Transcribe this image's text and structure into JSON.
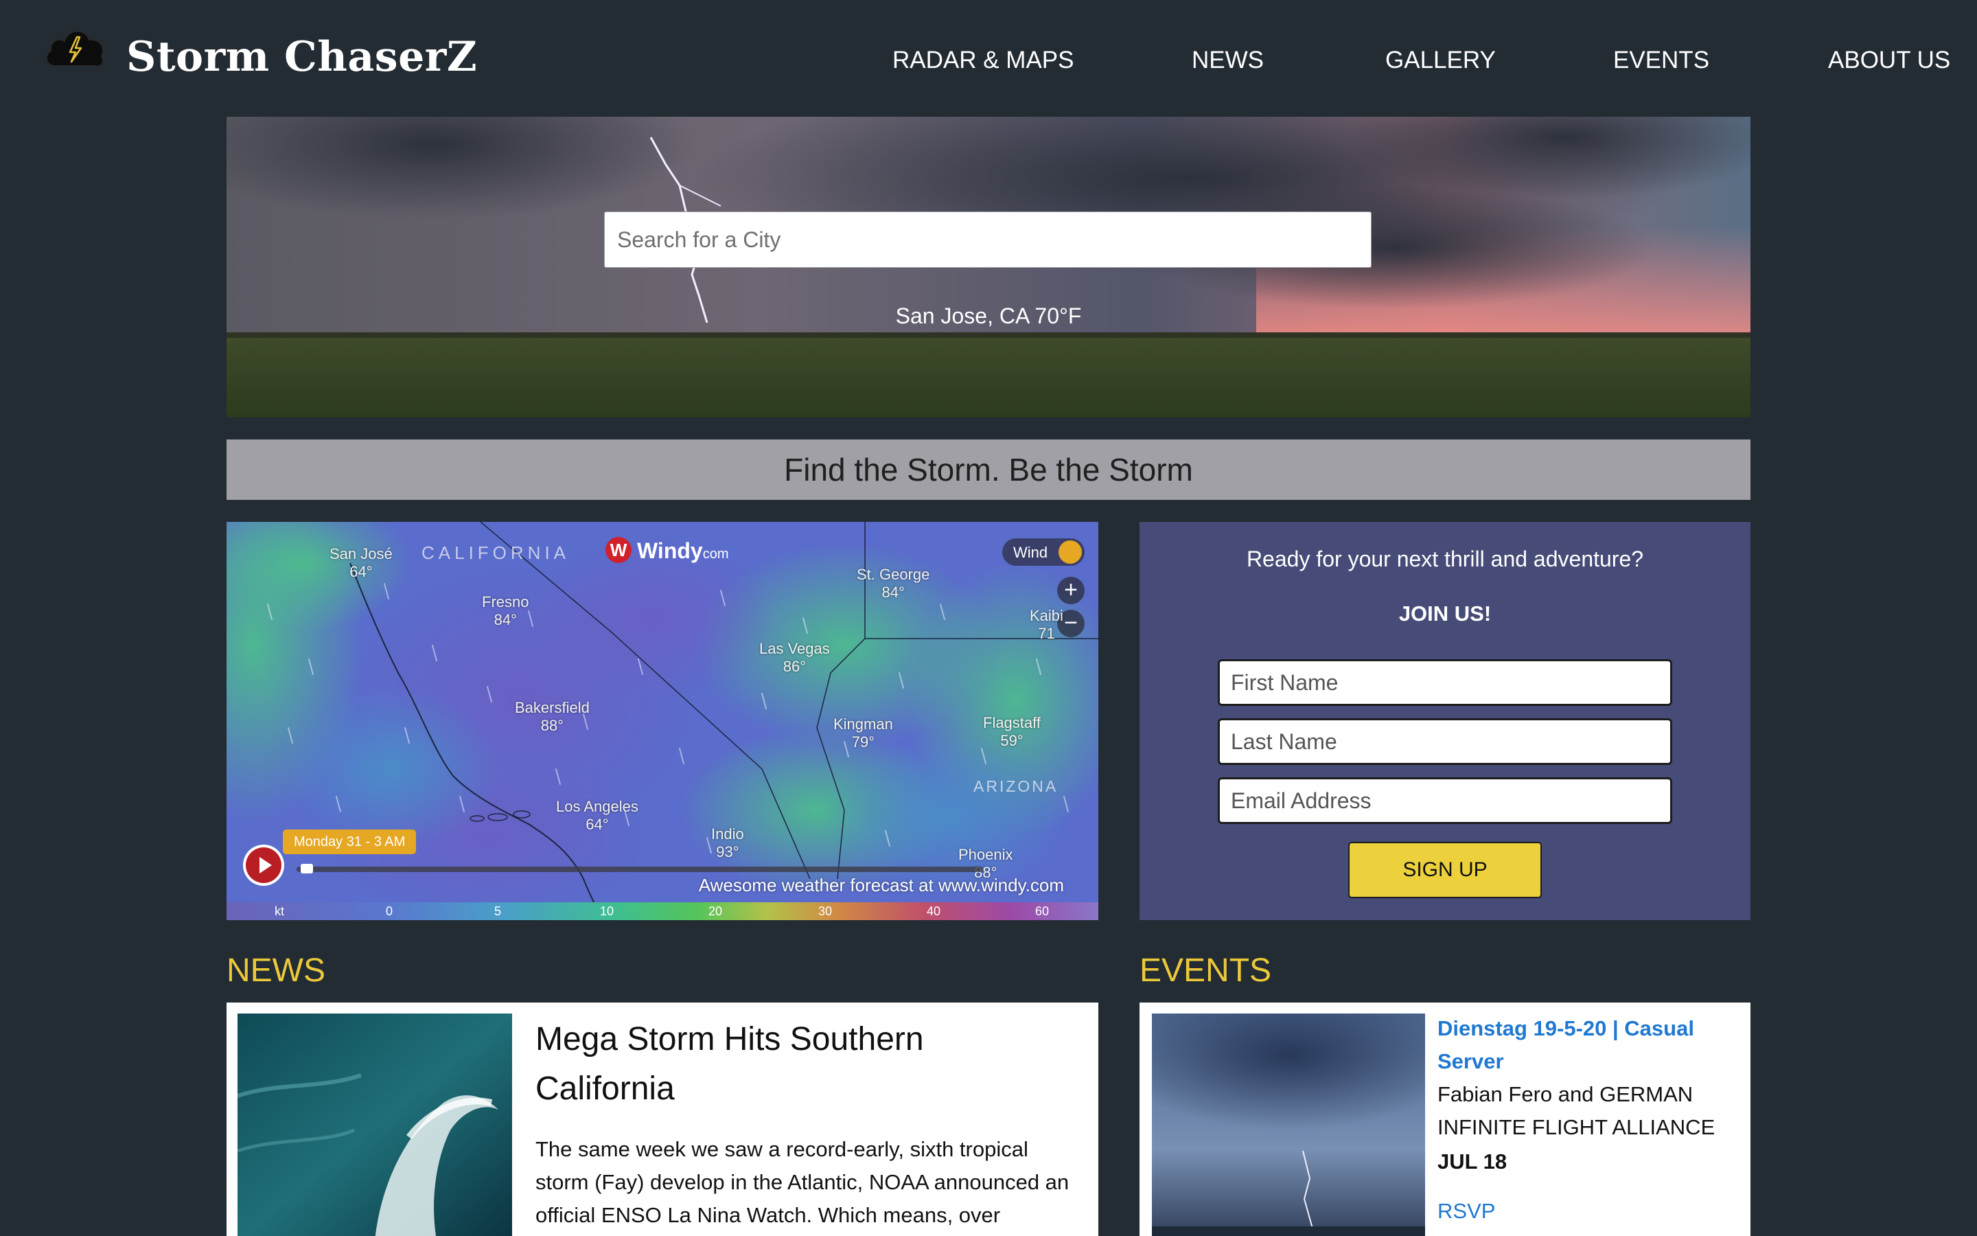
{
  "header": {
    "brand": "Storm ChaserZ",
    "nav": [
      {
        "label": "RADAR & MAPS"
      },
      {
        "label": "NEWS"
      },
      {
        "label": "GALLERY"
      },
      {
        "label": "EVENTS"
      },
      {
        "label": "ABOUT US"
      }
    ]
  },
  "hero": {
    "search_placeholder": "Search for a City",
    "location": "San Jose, CA 70°F"
  },
  "tagline": "Find the Storm. Be the Storm",
  "map": {
    "brand": "Windy",
    "brand_suffix": "com",
    "layer_label": "Wind",
    "zoom_in": "+",
    "zoom_out": "−",
    "regions": [
      "CALIFORNIA",
      "ARIZONA"
    ],
    "cities": [
      {
        "name": "San José",
        "temp": "64°"
      },
      {
        "name": "Fresno",
        "temp": "84°"
      },
      {
        "name": "St. George",
        "temp": "84°"
      },
      {
        "name": "Kaibi",
        "temp": "71"
      },
      {
        "name": "Las Vegas",
        "temp": "86°"
      },
      {
        "name": "Bakersfield",
        "temp": "88°"
      },
      {
        "name": "Kingman",
        "temp": "79°"
      },
      {
        "name": "Flagstaff",
        "temp": "59°"
      },
      {
        "name": "Los Angeles",
        "temp": "64°"
      },
      {
        "name": "Indio",
        "temp": "93°"
      },
      {
        "name": "Phoenix",
        "temp": "88°"
      }
    ],
    "time_badge": "Monday 31 - 3 AM",
    "forecast_text": "Awesome weather forecast at www.windy.com",
    "scale": [
      "kt",
      "0",
      "5",
      "10",
      "20",
      "30",
      "40",
      "60"
    ]
  },
  "signup": {
    "lead": "Ready for your next thrill and adventure?",
    "join": "JOIN US!",
    "first_name_placeholder": "First Name",
    "last_name_placeholder": "Last Name",
    "email_placeholder": "Email Address",
    "button": "SIGN UP"
  },
  "news": {
    "heading": "NEWS",
    "title": "Mega Storm Hits Southern California",
    "body": "The same week we saw a record-early, sixth tropical storm (Fay) develop in the Atlantic, NOAA announced an official ENSO La Nina Watch. Which means, over"
  },
  "events": {
    "heading": "EVENTS",
    "title": "Dienstag 19-5-20 | Casual Server",
    "host": "Fabian Fero and GERMAN INFINITE FLIGHT ALLIANCE",
    "date": "JUL 18",
    "rsvp": "RSVP"
  },
  "colors": {
    "page_bg": "#232b33",
    "accent_yellow": "#ecc93a",
    "signup_bg": "#464c77",
    "button_yellow": "#ecd13c",
    "link_blue": "#1f78d1",
    "tagline_bg": "#a0a0a6"
  }
}
